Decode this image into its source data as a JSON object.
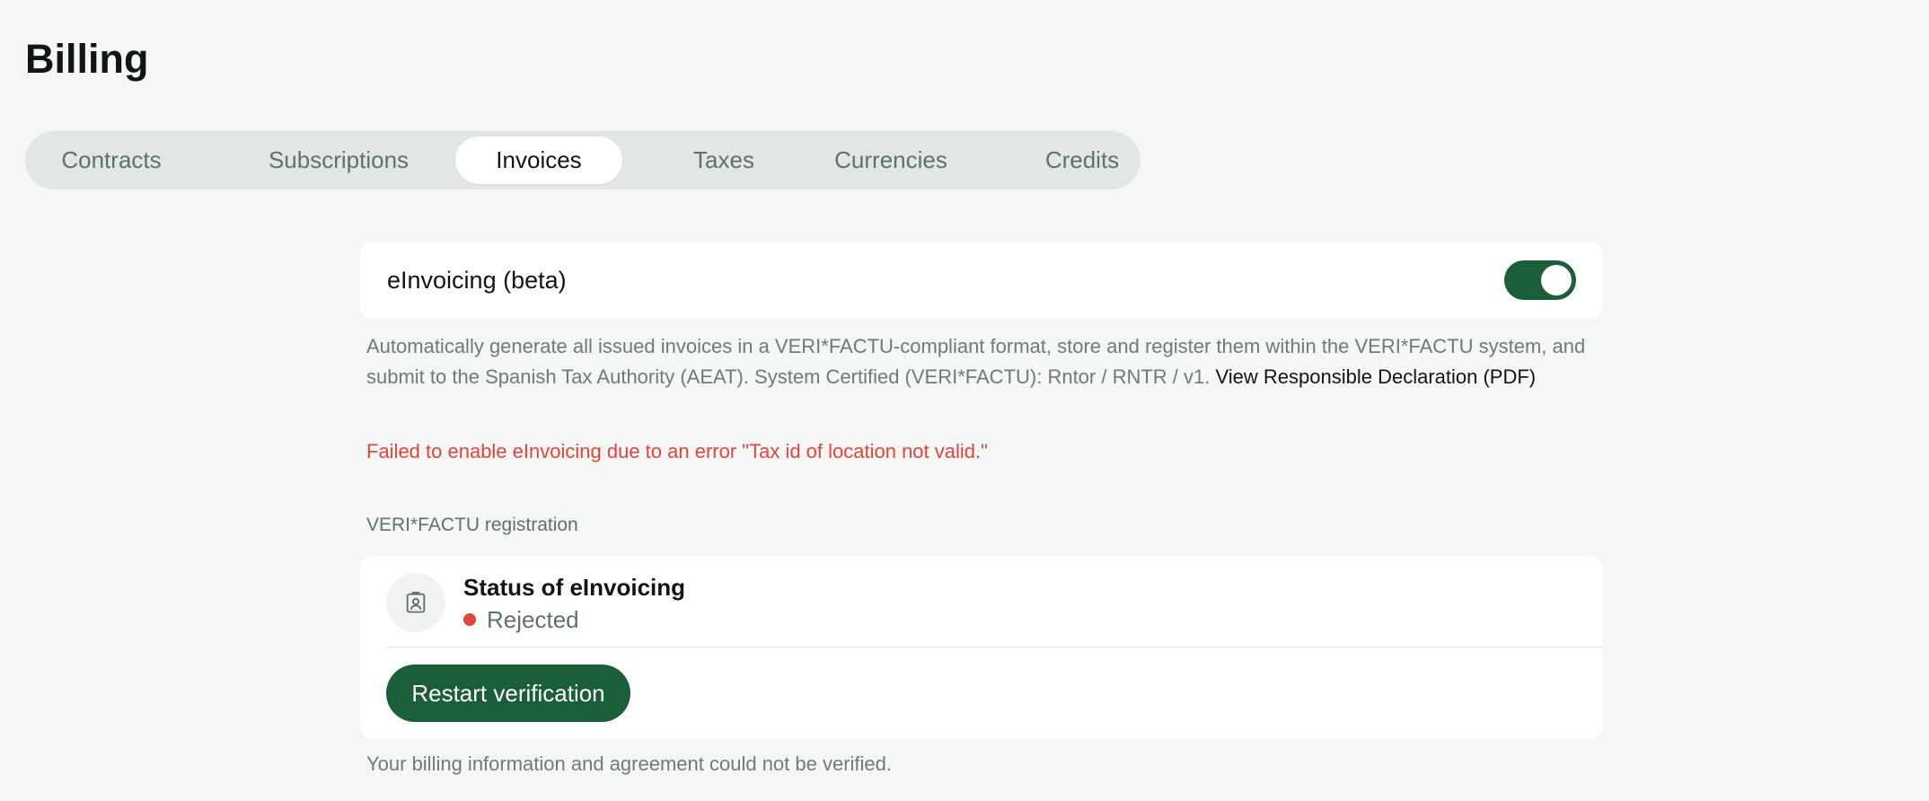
{
  "page": {
    "title": "Billing"
  },
  "tabs": [
    {
      "label": "Contracts",
      "active": false
    },
    {
      "label": "Subscriptions",
      "active": false
    },
    {
      "label": "Invoices",
      "active": true
    },
    {
      "label": "Taxes",
      "active": false
    },
    {
      "label": "Currencies",
      "active": false
    },
    {
      "label": "Credits",
      "active": false
    }
  ],
  "einvoicing": {
    "title": "eInvoicing (beta)",
    "toggle_on": true,
    "description": "Automatically generate all issued invoices in a VERI*FACTU-compliant format, store and register them within the VERI*FACTU system, and submit to the Spanish Tax Authority (AEAT). System Certified (VERI*FACTU): Rntor / RNTR / v1. ",
    "declaration_link": "View Responsible Declaration (PDF)",
    "error": "Failed to enable eInvoicing due to an error \"Tax id of location not valid.\""
  },
  "registration": {
    "section_label": "VERI*FACTU registration",
    "status_title": "Status of eInvoicing",
    "status_value": "Rejected",
    "status_icon": "id-badge-icon",
    "restart_label": "Restart verification",
    "footnote": "Your billing information and agreement could not be verified."
  },
  "colors": {
    "accent": "#1b5e3a",
    "error": "#e0453a",
    "muted": "#5e7368",
    "background": "#f5f7f6"
  }
}
